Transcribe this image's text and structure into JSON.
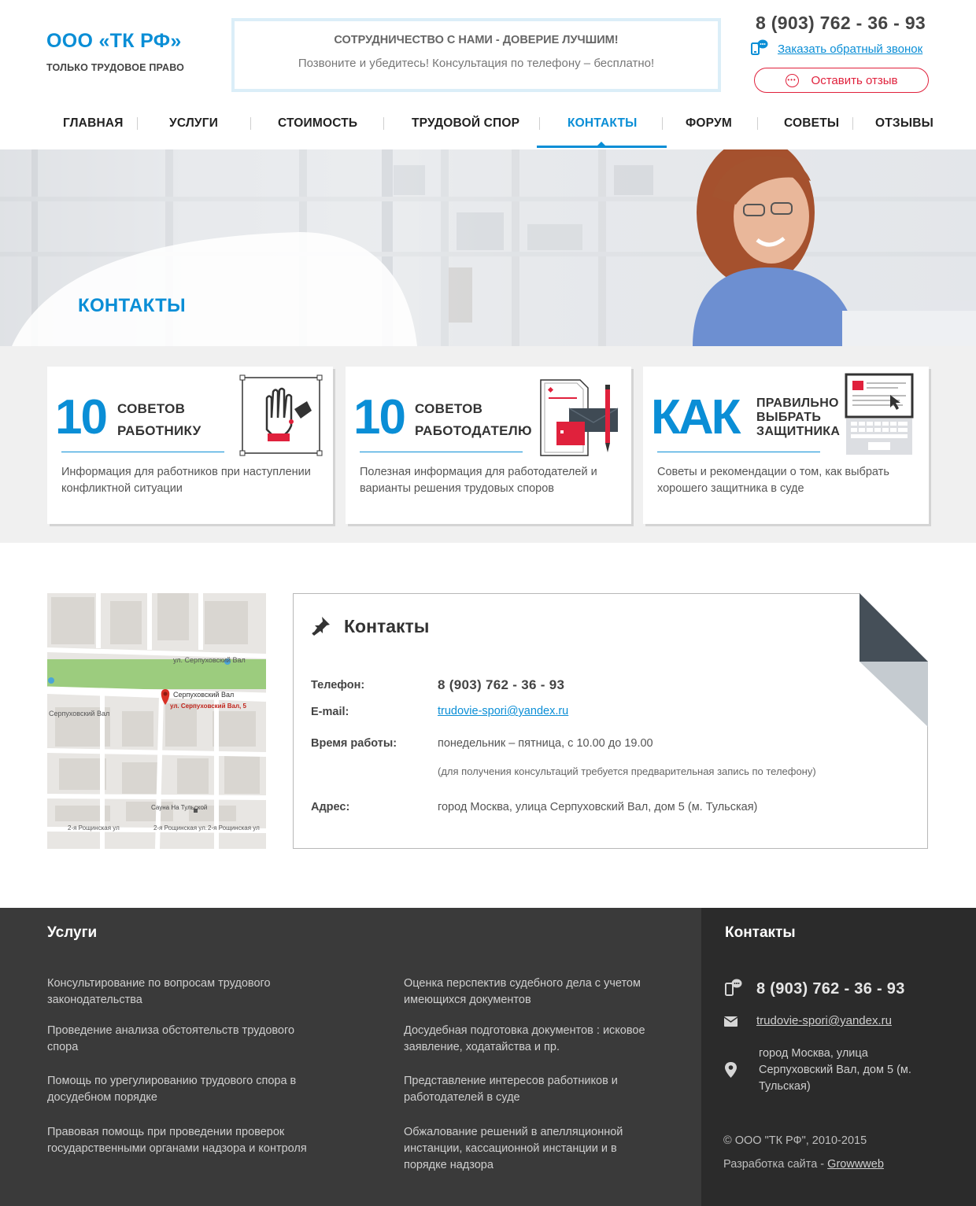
{
  "header": {
    "company_name": "ООО «ТК РФ»",
    "tagline": "ТОЛЬКО ТРУДОВОЕ ПРАВО",
    "promo_title": "СОТРУДНИЧЕСТВО С НАМИ - ДОВЕРИЕ ЛУЧШИМ!",
    "promo_text": "Позвоните и убедитесь! Консультация по телефону – бесплатно!",
    "phone": "8 (903) 762 - 36 - 93",
    "callback_label": "Заказать обратный звонок",
    "review_label": "Оставить отзыв",
    "accent_color": "#0a8ed6",
    "alert_color": "#e0213c"
  },
  "nav": {
    "items": [
      {
        "label": "ГЛАВНАЯ"
      },
      {
        "label": "УСЛУГИ"
      },
      {
        "label": "СТОИМОСТЬ"
      },
      {
        "label": "ТРУДОВОЙ СПОР"
      },
      {
        "label": "КОНТАКТЫ",
        "active": true
      },
      {
        "label": "ФОРУМ"
      },
      {
        "label": "СОВЕТЫ"
      },
      {
        "label": "ОТЗЫВЫ"
      }
    ]
  },
  "hero": {
    "title": "КОНТАКТЫ"
  },
  "cards": [
    {
      "big": "10",
      "head1": "СОВЕТОВ",
      "head2": "РАБОТНИКУ",
      "desc": "Информация для работников при наступлении конфликтной ситуации",
      "icon": "hand-paint-icon"
    },
    {
      "big": "10",
      "head1": "СОВЕТОВ",
      "head2": "РАБОТОДАТЕЛЮ",
      "desc": "Полезная информация для работодателей и варианты решения трудовых споров",
      "icon": "documents-pen-icon"
    },
    {
      "big": "КАК",
      "head1": "ПРАВИЛЬНО",
      "head2": "ВЫБРАТЬ",
      "head3": "ЗАЩИТНИКА",
      "desc": "Советы и рекомендации о том, как выбрать хорошего защитника в суде",
      "icon": "laptop-icon"
    }
  ],
  "map": {
    "street_top": "ул. Серпуховский Вал",
    "street_mid": "Серпуховский Вал",
    "street_left": "Серпуховский Вал",
    "marker_label": "ул. Серпуховский Вал, 5",
    "poi": "Сауна На Тульской",
    "street_bottom_1": "2-я Рощинская ул",
    "street_bottom_2": "2-я Рощинская ул.",
    "street_bottom_3": "2-я Рощинская ул"
  },
  "contacts": {
    "title": "Контакты",
    "phone_label": "Телефон:",
    "phone": "8 (903) 762 - 36 - 93",
    "email_label": "E-mail:",
    "email": "trudovie-spori@yandex.ru",
    "hours_label": "Время работы:",
    "hours": "понедельник – пятница, с 10.00 до 19.00",
    "hours_note": "(для получения консультаций требуется предварительная запись по телефону)",
    "address_label": "Адрес:",
    "address": "город Москва, улица Серпуховский Вал, дом 5 (м. Тульская)"
  },
  "footer": {
    "services_title": "Услуги",
    "services": [
      "Консультирование по вопросам трудового законодательства",
      "Оценка перспектив судебного дела с учетом имеющихся документов",
      "Проведение анализа обстоятельств трудового спора",
      "Досудебная подготовка документов : исковое заявление, ходатайства и пр.",
      "Помощь по урегулированию трудового спора в досудебном порядке",
      "Представление интересов работников и работодателей в суде",
      "Правовая помощь при проведении проверок государственными органами надзора и контроля",
      "Обжалование решений в апелляционной инстанции, кассационной инстанции и в порядке надзора"
    ],
    "contacts_title": "Контакты",
    "phone": "8 (903) 762 - 36 - 93",
    "email": "trudovie-spori@yandex.ru",
    "address": "город Москва, улица Серпуховский Вал, дом 5 (м. Тульская)",
    "copyright": "© ООО \"ТК РФ\", 2010-2015",
    "dev_prefix": "Разработка сайта - ",
    "dev_link": "Growwweb"
  }
}
